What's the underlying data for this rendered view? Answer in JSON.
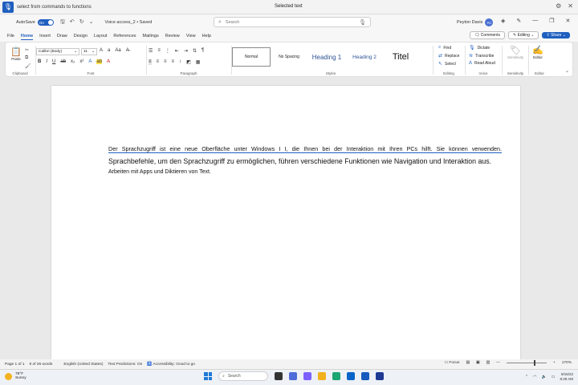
{
  "voice_bar": {
    "command_text": "select from commands to functions",
    "state_text": "Selected text"
  },
  "titlebar": {
    "autosave_label": "AutoSave",
    "toggle_label": "On",
    "doc_title": "Voice access_2 • Saved",
    "search_placeholder": "Search",
    "user_name": "Peyton Davis",
    "user_initials": "PD"
  },
  "tabs": [
    "File",
    "Home",
    "Insert",
    "Draw",
    "Design",
    "Layout",
    "References",
    "Mailings",
    "Review",
    "View",
    "Help"
  ],
  "tab_actions": {
    "comments": "Comments",
    "editing": "Editing",
    "share": "Share"
  },
  "ribbon": {
    "clipboard": {
      "paste": "Paste",
      "label": "Clipboard"
    },
    "font": {
      "name": "Calibri (Body)",
      "size": "11",
      "label": "Font"
    },
    "paragraph": {
      "label": "Paragraph"
    },
    "styles": {
      "label": "Styles",
      "items": [
        "Normal",
        "No Spacing",
        "Heading 1",
        "Heading 2",
        "Titel"
      ]
    },
    "editing": {
      "label": "Editing",
      "items": [
        "Find",
        "Replace",
        "Select"
      ]
    },
    "voice": {
      "label": "Voice",
      "items": [
        "Dictate",
        "Transcribe",
        "Read Aloud"
      ]
    },
    "sensitivity": {
      "label": "Sensitivity",
      "item": "Sensitivity"
    },
    "editor": {
      "label": "Editor",
      "item": "Editor"
    }
  },
  "document": {
    "line1": "Der Sprachzugriff ist eine neue Oberfläche unter Windows I I, die Ihnen bei der Interaktion mit Ihren PCs hilft. Sie können verwenden.",
    "line2": "Sprachbefehle, um den Sprachzugriff zu ermöglichen, führen verschiedene Funktionen wie Navigation und Interaktion aus.",
    "line3": "Arbeiten mit Apps und Diktieren von Text."
  },
  "statusbar": {
    "page": "Page 1 of 1",
    "words": "8 of 26 words",
    "language": "English (United States)",
    "predictions": "Text Predictions: On",
    "accessibility": "Accessibility: Good to go",
    "focus": "Focus",
    "zoom": "170%",
    "zoom_level": 0.7
  },
  "taskbar": {
    "weather_temp": "78°F",
    "weather_desc": "Sunny",
    "search": "Search",
    "date": "9/15/22",
    "time": "8:28 AM"
  }
}
